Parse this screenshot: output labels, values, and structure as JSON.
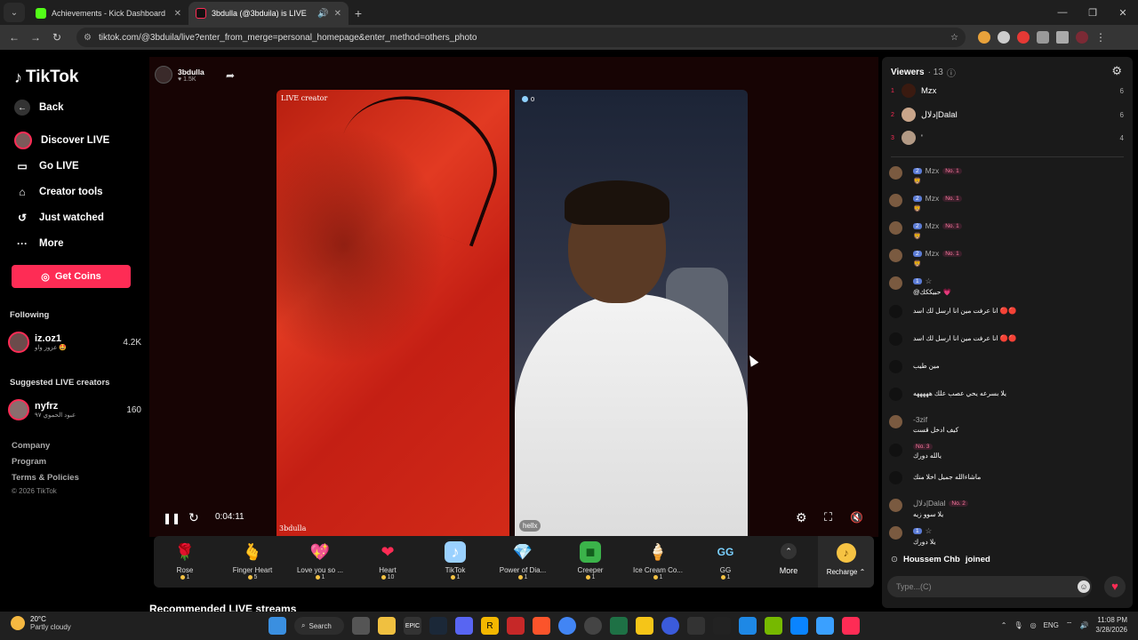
{
  "browser": {
    "tabs": [
      {
        "title": "Achievements - Kick Dashboard",
        "color": "#53fc18"
      },
      {
        "title": "3bdulla (@3bduila) is LIVE",
        "color": "#fe2c55"
      }
    ],
    "url": "tiktok.com/@3bduila/live?enter_from_merge=personal_homepage&enter_method=others_photo"
  },
  "sidebar": {
    "logo": "TikTok",
    "back": "Back",
    "items": [
      {
        "label": "Discover LIVE"
      },
      {
        "label": "Go LIVE"
      },
      {
        "label": "Creator tools"
      },
      {
        "label": "Just watched"
      },
      {
        "label": "More"
      }
    ],
    "get_coins": "Get Coins",
    "following_title": "Following",
    "following": [
      {
        "name": "iz.oz1",
        "sub": "عزوز واو 🤩",
        "count": "4.2K"
      }
    ],
    "suggested_title": "Suggested LIVE creators",
    "suggested": [
      {
        "name": "nyfrz",
        "sub": "عبود الحموي ٩٧",
        "count": "160"
      }
    ],
    "footer": [
      "Company",
      "Program",
      "Terms & Policies"
    ],
    "copyright": "© 2026 TikTok"
  },
  "stream": {
    "host_name": "3bdulla",
    "host_likes": "1.5K",
    "left_tag": "LIVE creator",
    "left_name": "3bdulla",
    "right_viewers": "0",
    "right_name": "hellx",
    "timer": "0:04:11"
  },
  "gifts": [
    {
      "name": "Rose",
      "price": "1",
      "icon": "🌹"
    },
    {
      "name": "Finger Heart",
      "price": "5",
      "icon": "🫰"
    },
    {
      "name": "Love you so ...",
      "price": "1",
      "icon": "💖"
    },
    {
      "name": "Heart",
      "price": "10",
      "icon": "❤"
    },
    {
      "name": "TikTok",
      "price": "1",
      "icon": "♪"
    },
    {
      "name": "Power of Dia...",
      "price": "1",
      "icon": "💎"
    },
    {
      "name": "Creeper",
      "price": "1",
      "icon": "■"
    },
    {
      "name": "Ice Cream Co...",
      "price": "1",
      "icon": "🍦"
    },
    {
      "name": "GG",
      "price": "1",
      "icon": "GG"
    }
  ],
  "gift_more": "More",
  "recharge": "Recharge",
  "recommended_title": "Recommended LIVE streams",
  "chat": {
    "title": "Viewers",
    "count": "· 13",
    "top_viewers": [
      {
        "rank": "1",
        "name": "Mzx",
        "score": "6"
      },
      {
        "rank": "2",
        "name": "دلال|Dalal",
        "score": "6"
      },
      {
        "rank": "3",
        "name": "'",
        "score": "4"
      }
    ],
    "messages": [
      {
        "level": "2",
        "name": "Mzx",
        "badge": "No. 1",
        "text": "🦁"
      },
      {
        "level": "2",
        "name": "Mzx",
        "badge": "No. 1",
        "text": "🦁"
      },
      {
        "level": "2",
        "name": "Mzx",
        "badge": "No. 1",
        "text": "🦁"
      },
      {
        "level": "2",
        "name": "Mzx",
        "badge": "No. 1",
        "text": "🦁"
      },
      {
        "level": "1",
        "name": "☆",
        "badge": "",
        "text": "@حبيككك 💗"
      },
      {
        "level": "",
        "name": "",
        "badge": "",
        "text": "انا عرفت مين انا ارسل لك اسد 🔴🔴"
      },
      {
        "level": "",
        "name": "",
        "badge": "",
        "text": "انا عرفت مين انا ارسل لك اسد 🔴🔴"
      },
      {
        "level": "",
        "name": "",
        "badge": "",
        "text": "مين طيب"
      },
      {
        "level": "",
        "name": "",
        "badge": "",
        "text": "يلا بسرعه يحي عصب علك هههههه"
      },
      {
        "level": "",
        "name": "-3zif",
        "badge": "",
        "text": "كيف ادخل قست"
      },
      {
        "level": "",
        "name": "",
        "badge": "No. 3",
        "text": "يالله دورك"
      },
      {
        "level": "",
        "name": "",
        "badge": "",
        "text": "ماشاءالله جميل اخلا منك"
      },
      {
        "level": "",
        "name": "دلال|Dalal",
        "badge": "No. 2",
        "text": "يلا سوو زيه"
      },
      {
        "level": "1",
        "name": "☆",
        "badge": "",
        "text": "يلا دورك"
      }
    ],
    "joined_user": "Houssem Chb",
    "joined_text": "joined",
    "input_placeholder": "Type...(C)"
  },
  "taskbar": {
    "temp": "20°C",
    "weather": "Partly cloudy",
    "search": "Search",
    "lang": "ENG",
    "time": "11:08 PM",
    "date": "3/28/2026"
  }
}
